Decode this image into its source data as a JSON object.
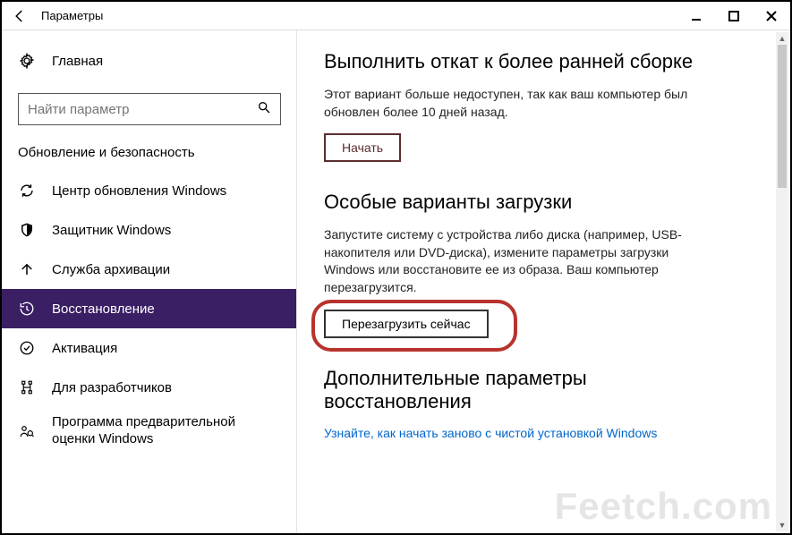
{
  "titlebar": {
    "title": "Параметры"
  },
  "sidebar": {
    "home_label": "Главная",
    "search_placeholder": "Найти параметр",
    "category": "Обновление и безопасность",
    "items": [
      {
        "label": "Центр обновления Windows"
      },
      {
        "label": "Защитник Windows"
      },
      {
        "label": "Служба архивации"
      },
      {
        "label": "Восстановление"
      },
      {
        "label": "Активация"
      },
      {
        "label": "Для разработчиков"
      },
      {
        "label": "Программа предварительной оценки Windows"
      }
    ]
  },
  "content": {
    "section1": {
      "title": "Выполнить откат к более ранней сборке",
      "desc": "Этот вариант больше недоступен, так как ваш компьютер был обновлен более 10 дней назад.",
      "button": "Начать"
    },
    "section2": {
      "title": "Особые варианты загрузки",
      "desc": "Запустите систему с устройства либо диска (например, USB-накопителя или DVD-диска), измените параметры загрузки Windows или восстановите ее из образа. Ваш компьютер перезагрузится.",
      "button": "Перезагрузить сейчас"
    },
    "section3": {
      "title": "Дополнительные параметры восстановления",
      "link": "Узнайте, как начать заново с чистой установкой Windows"
    }
  },
  "watermark": "Feetch.com"
}
